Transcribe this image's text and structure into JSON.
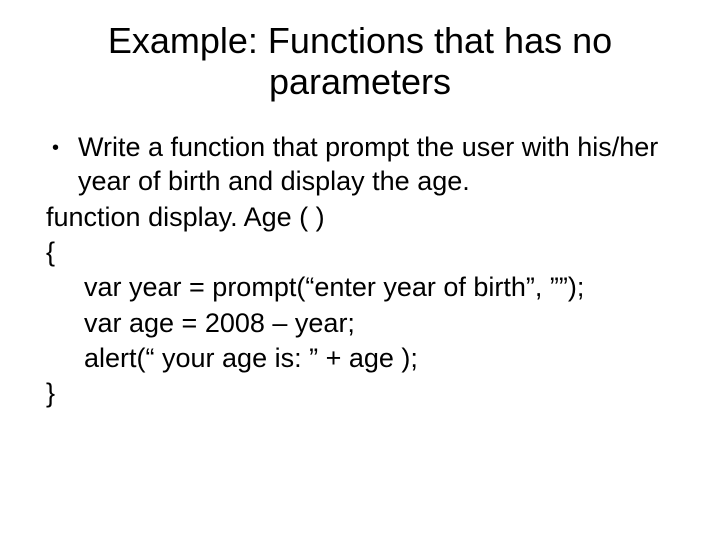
{
  "title": "Example: Functions that has no parameters",
  "bullet": {
    "text": "Write a function that prompt the user with his/her year of birth and display the age."
  },
  "code": {
    "line1": "function display. Age (  )",
    "line2": "{",
    "line3": "var year = prompt(“enter year of birth”, ””);",
    "line4": "var age = 2008 – year;",
    "line5": "alert(“ your age is: ” + age );",
    "line6": "}"
  }
}
